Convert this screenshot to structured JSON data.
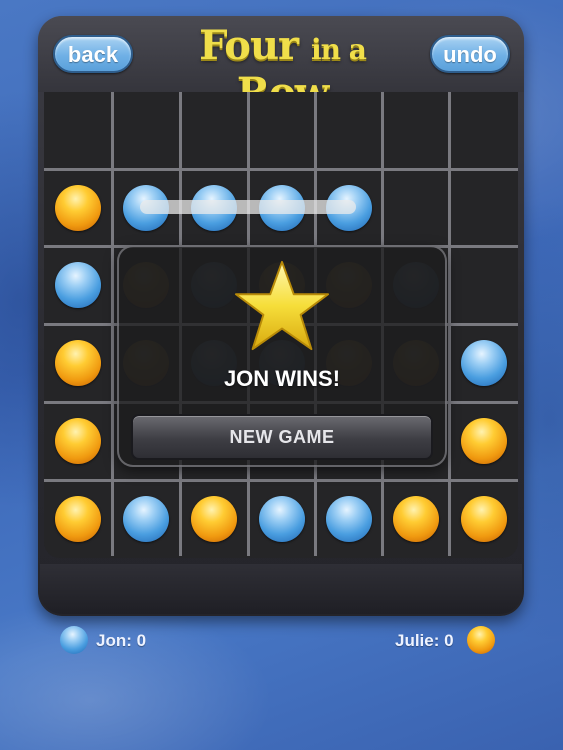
{
  "header": {
    "back_label": "back",
    "undo_label": "undo",
    "title_word1": "Four",
    "title_word2": "in a",
    "title_word3": "Row"
  },
  "colors": {
    "player_jon": "#4a9ee0",
    "player_julie": "#f0a010",
    "title": "#f0de4a"
  },
  "board": {
    "columns": 7,
    "rows": 6,
    "cells": [
      [
        null,
        null,
        null,
        null,
        null,
        null,
        null
      ],
      [
        "yellow",
        "blue",
        "blue",
        "blue",
        "blue",
        null,
        null
      ],
      [
        "blue",
        "yellow",
        "blue",
        "yellow",
        "yellow",
        "blue",
        null
      ],
      [
        "yellow",
        "yellow",
        "blue",
        "blue",
        "yellow",
        "yellow",
        "blue"
      ],
      [
        "yellow",
        null,
        null,
        null,
        null,
        null,
        "yellow"
      ],
      [
        "yellow",
        "blue",
        "yellow",
        "blue",
        "blue",
        "yellow",
        "yellow"
      ]
    ]
  },
  "result": {
    "message": "JON WINS!",
    "new_game_label": "NEW GAME",
    "icon": "star-icon"
  },
  "scores": {
    "jon": "Jon: 0",
    "julie": "Julie: 0"
  }
}
